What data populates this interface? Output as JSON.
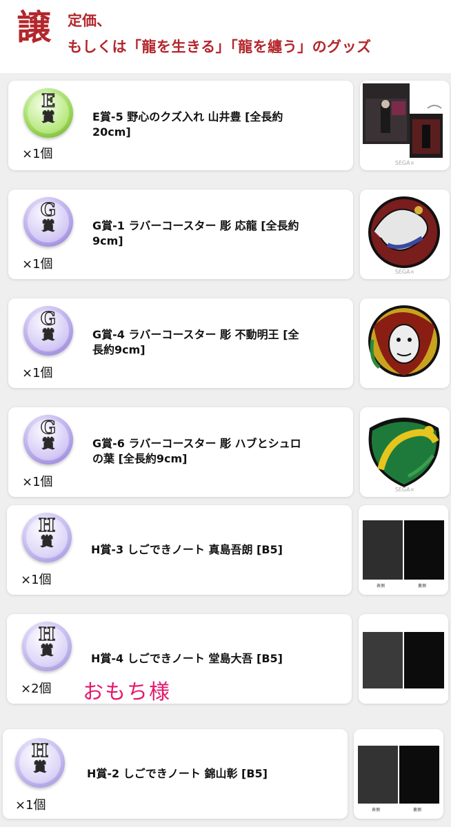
{
  "header": {
    "big_char": "譲",
    "line1": "定価、",
    "line2": "もしくは「龍を生きる」「龍を纏う」のグッズ",
    "color": "#b3262b"
  },
  "items": [
    {
      "grade_letter": "E",
      "grade_sho": "賞",
      "badge_color": "green",
      "name": "E賞-5 野心のクズ入れ 山井豊 [全長約20cm]",
      "name_l1": "E賞-5 野心のクズ入れ 山井豊 [全長約",
      "name_l2": "20cm]",
      "qty": "×1個",
      "thumb": "waste-bin-photo"
    },
    {
      "grade_letter": "G",
      "grade_sho": "賞",
      "badge_color": "purple",
      "name_l1": "G賞-1 ラバーコースター 彫 応龍 [全長約",
      "name_l2": "9cm]",
      "qty": "×1個",
      "thumb": "coaster-dragon"
    },
    {
      "grade_letter": "G",
      "grade_sho": "賞",
      "badge_color": "purple",
      "name_l1": "G賞-4 ラバーコースター 彫 不動明王 [全",
      "name_l2": "長約9cm]",
      "qty": "×1個",
      "thumb": "coaster-fudo"
    },
    {
      "grade_letter": "G",
      "grade_sho": "賞",
      "badge_color": "purple",
      "name_l1": "G賞-6 ラバーコースター 彫 ハブとシュロ",
      "name_l2": "の葉 [全長約9cm]",
      "qty": "×1個",
      "thumb": "coaster-habu"
    },
    {
      "grade_letter": "H",
      "grade_sho": "賞",
      "badge_color": "lavender",
      "name_l1": "H賞-3 しごできノート 真島吾朗 [B5]",
      "qty": "×1個",
      "thumb": "notebook-majima",
      "cap_front": "表側",
      "cap_back": "裏側"
    },
    {
      "grade_letter": "H",
      "grade_sho": "賞",
      "badge_color": "lavender",
      "name_l1": "H賞-4 しごできノート 堂島大吾 [B5]",
      "qty": "×2個",
      "thumb": "notebook-daigo",
      "winner": "おもち様"
    },
    {
      "grade_letter": "H",
      "grade_sho": "賞",
      "badge_color": "lavender",
      "name_l1": "H賞-2 しごできノート 錦山彰 [B5]",
      "qty": "×1個",
      "thumb": "notebook-nishikiyama",
      "cap_front": "表側",
      "cap_back": "裏側"
    }
  ],
  "watermark": "SEGA×"
}
